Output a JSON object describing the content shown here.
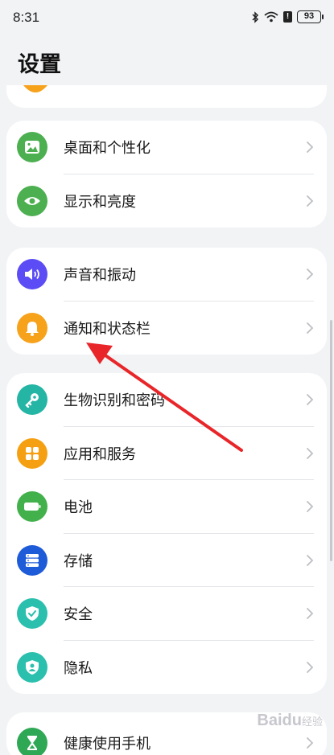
{
  "status_bar": {
    "time": "8:31",
    "battery": "93",
    "alert": "!"
  },
  "page": {
    "title": "设置"
  },
  "groups": [
    {
      "items": [
        {
          "label": "桌面和个性化",
          "icon": "image-icon",
          "color": "#4caf50"
        },
        {
          "label": "显示和亮度",
          "icon": "eye-icon",
          "color": "#4caf50"
        }
      ]
    },
    {
      "items": [
        {
          "label": "声音和振动",
          "icon": "speaker-icon",
          "color": "#5b4cf5"
        },
        {
          "label": "通知和状态栏",
          "icon": "bell-icon",
          "color": "#f7a21b"
        }
      ]
    },
    {
      "items": [
        {
          "label": "生物识别和密码",
          "icon": "key-icon",
          "color": "#24b5a5"
        },
        {
          "label": "应用和服务",
          "icon": "apps-icon",
          "color": "#f5a012"
        },
        {
          "label": "电池",
          "icon": "battery-icon",
          "color": "#43b14b"
        },
        {
          "label": "存储",
          "icon": "storage-icon",
          "color": "#1e5bd8"
        },
        {
          "label": "安全",
          "icon": "shield-icon",
          "color": "#2bbfae"
        },
        {
          "label": "隐私",
          "icon": "privacy-icon",
          "color": "#2bbfae"
        }
      ]
    },
    {
      "items": [
        {
          "label": "健康使用手机",
          "icon": "hourglass-icon",
          "color": "#2fa855"
        }
      ]
    }
  ],
  "watermark": {
    "brand": "Baidu",
    "sub": "经验"
  },
  "annotation": {
    "arrow_color": "#e8262a"
  }
}
